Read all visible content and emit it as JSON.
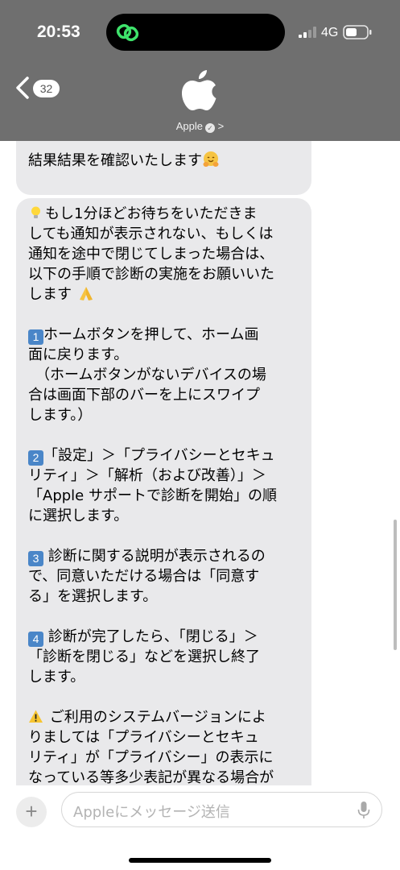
{
  "status_bar": {
    "time": "20:53",
    "network": "4G"
  },
  "header": {
    "back_count": "32",
    "contact_name": "Apple",
    "verified_mark": "✓",
    "chevron": ">"
  },
  "messages": [
    {
      "lines": [
        "結果結果を確認いたします"
      ],
      "trailing_emoji": "hugging-face"
    },
    {
      "paragraphs": [
        {
          "icon": "lightbulb-icon",
          "lines": [
            "もし1分ほどお待ちをいただきま",
            "しても通知が表示されない、もしくは",
            "通知を途中で閉じてしまった場合は、",
            "以下の手順で診断の実施をお願いいた",
            "します"
          ],
          "trailing_emoji": "folded-hands"
        },
        {
          "keycap": "1",
          "lines": [
            "ホームボタンを押して、ホーム画",
            "面に戻ります。",
            "　（ホームボタンがないデバイスの場",
            "合は画面下部のバーを上にスワイプ",
            "します。）"
          ]
        },
        {
          "keycap": "2",
          "lines": [
            "「設定」＞「プライバシーとセキュ",
            "リティ」＞「解析（および改善）」＞",
            "「Apple サポートで診断を開始」の順",
            "に選択します。"
          ]
        },
        {
          "keycap": "3",
          "lines": [
            " 診断に関する説明が表示されるの",
            "で、同意いただける場合は「同意す",
            "る」を選択します。"
          ]
        },
        {
          "keycap": "4",
          "lines": [
            " 診断が完了したら、「閉じる」＞",
            "「診断を閉じる」などを選択し終了",
            "します。"
          ]
        },
        {
          "icon": "warning-icon",
          "lines": [
            " ご利用のシステムバージョンによ",
            "りましては「プライバシーとセキュ",
            "リティ」が「プライバシー」の表示に",
            "なっている等多少表記が異なる場合が"
          ]
        }
      ]
    }
  ],
  "composer": {
    "placeholder": "Appleにメッセージ送信",
    "plus": "+"
  },
  "colors": {
    "header_bg": "#6f6f6f",
    "bubble_bg": "#e9e9eb",
    "keycap": "#4a86c8"
  }
}
